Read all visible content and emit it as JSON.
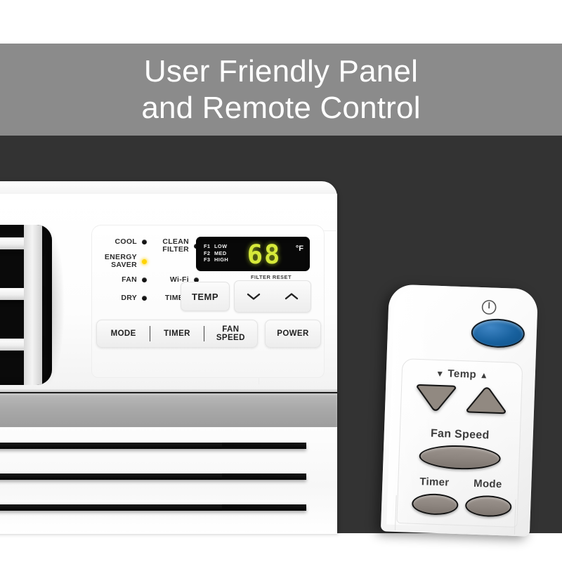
{
  "headline": {
    "line1": "User Friendly Panel",
    "line2": "and Remote Control"
  },
  "colors": {
    "header_band": "#8b8b8b",
    "dark_background": "#333333",
    "led_on": "#ffd400",
    "display_digits": "#d6e93a",
    "power_button": "#18619e",
    "remote_button": "#8d857f"
  },
  "ac_panel": {
    "indicators": [
      {
        "label": "COOL",
        "state": "off"
      },
      {
        "label": "ENERGY\nSAVER",
        "state": "on"
      },
      {
        "label": "FAN",
        "state": "off"
      },
      {
        "label": "DRY",
        "state": "off"
      },
      {
        "label": "CLEAN\nFILTER",
        "state": "off"
      },
      {
        "label": "Wi-Fi",
        "state": "off"
      },
      {
        "label": "TIMER",
        "state": "off"
      }
    ],
    "display": {
      "fan_codes": [
        {
          "code": "F1",
          "speed": "LOW"
        },
        {
          "code": "F2",
          "speed": "MED"
        },
        {
          "code": "F3",
          "speed": "HIGH"
        }
      ],
      "temperature": "68",
      "unit": "°F"
    },
    "filter_reset_label": "FILTER RESET",
    "temp_label": "TEMP",
    "temp_down_icon": "chevron-down-icon",
    "temp_up_icon": "chevron-up-icon",
    "buttons": [
      {
        "label": "MODE"
      },
      {
        "label": "TIMER"
      },
      {
        "label": "FAN\nSPEED"
      }
    ],
    "power_label": "POWER"
  },
  "remote": {
    "power_icon": "power-icon",
    "temp_label": "Temp",
    "temp_down_marker": "▼",
    "temp_up_marker": "▲",
    "fan_speed_label": "Fan Speed",
    "timer_label": "Timer",
    "mode_label": "Mode"
  }
}
